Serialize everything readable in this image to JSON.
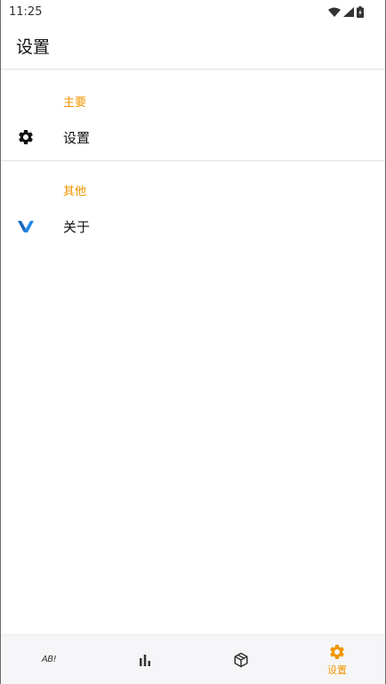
{
  "status_bar": {
    "time": "11:25",
    "icons": [
      "wifi-icon",
      "cellular-signal-icon",
      "battery-icon"
    ]
  },
  "app_bar": {
    "title": "设置"
  },
  "sections": [
    {
      "header": "主要",
      "items": [
        {
          "label": "设置",
          "icon": "gear-icon"
        }
      ]
    },
    {
      "header": "其他",
      "items": [
        {
          "label": "关于",
          "icon": "v-logo-icon"
        }
      ]
    }
  ],
  "bottom_nav": {
    "items": [
      {
        "icon": "abc-text-icon",
        "glyph": "AB!",
        "label": ""
      },
      {
        "icon": "bar-chart-icon",
        "label": ""
      },
      {
        "icon": "package-box-icon",
        "label": ""
      },
      {
        "icon": "gear-icon",
        "label": "设置",
        "active": true
      }
    ]
  },
  "colors": {
    "accent": "#f29600",
    "logo_blue": "#1e88e5",
    "nav_background": "#f6f6f8",
    "divider": "#e3e3e3"
  }
}
